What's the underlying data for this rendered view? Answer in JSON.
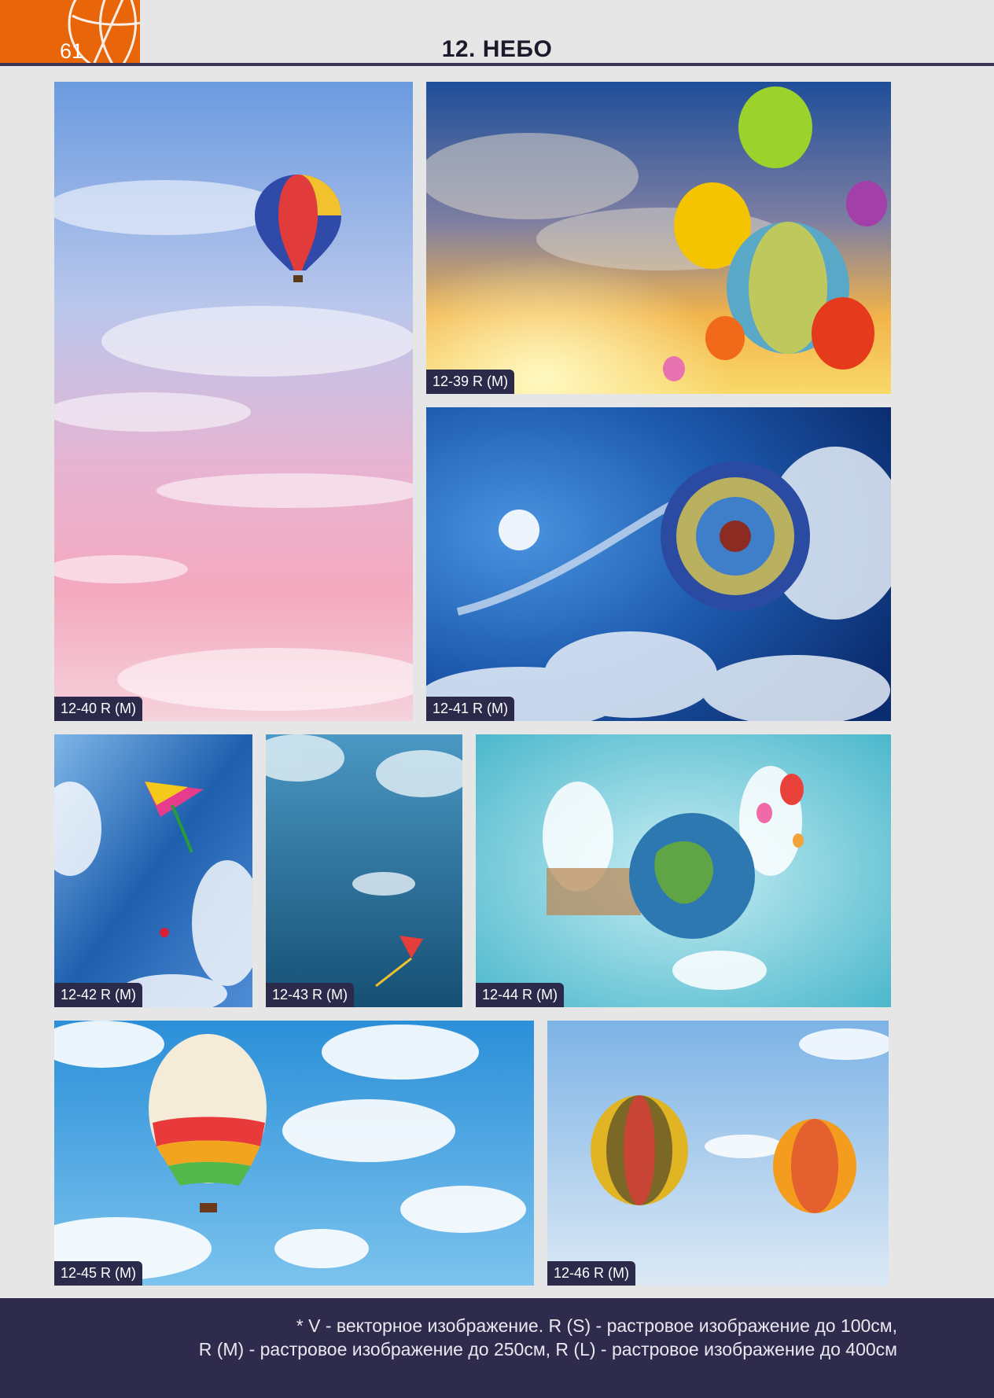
{
  "header": {
    "page_number": "61",
    "title": "12. НЕБО",
    "accent_color": "#e8650a",
    "rule_color": "#3a3457"
  },
  "images": [
    {
      "code": "12-40 R (M)",
      "subject": "balloon-pastel-sky"
    },
    {
      "code": "12-39 R (M)",
      "subject": "balloons-sunset-sky"
    },
    {
      "code": "12-41 R (M)",
      "subject": "balloon-from-below-blue-sky"
    },
    {
      "code": "12-42 R (M)",
      "subject": "kite-blue-sky"
    },
    {
      "code": "12-43 R (M)",
      "subject": "kite-teal-sky"
    },
    {
      "code": "12-44 R (M)",
      "subject": "globe-with-balloons"
    },
    {
      "code": "12-45 R (M)",
      "subject": "rainbow-balloon-clouds"
    },
    {
      "code": "12-46 R (M)",
      "subject": "two-balloons-sky"
    }
  ],
  "footer": {
    "line1": "* V - векторное изображение. R (S) - растровое изображение до 100см,",
    "line2": "R (M) - растровое изображение до 250см, R (L) - растровое изображение до 400см",
    "background": "#2f2b4c"
  }
}
